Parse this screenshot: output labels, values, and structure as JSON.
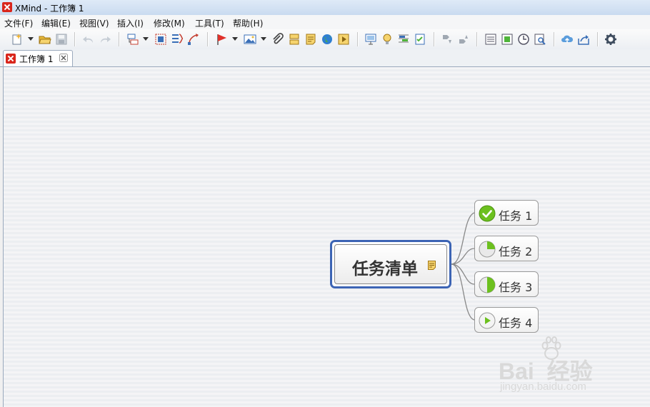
{
  "window": {
    "title": "XMind - 工作簿 1"
  },
  "menu": [
    "文件(F)",
    "编辑(E)",
    "视图(V)",
    "插入(I)",
    "修改(M)",
    "工具(T)",
    "帮助(H)"
  ],
  "tab": {
    "label": "工作簿 1"
  },
  "mindmap": {
    "central": "任务清单",
    "topics": [
      {
        "label": "任务 1",
        "icon": "progress-complete-icon"
      },
      {
        "label": "任务 2",
        "icon": "progress-quarter-icon"
      },
      {
        "label": "任务 3",
        "icon": "progress-half-icon"
      },
      {
        "label": "任务 4",
        "icon": "play-icon"
      }
    ]
  },
  "watermark": {
    "brand": "Bai  经验",
    "url": "jingyan.baidu.com"
  },
  "colors": {
    "central_border": "#3c64b4",
    "marker_green": "#6cc01e"
  }
}
